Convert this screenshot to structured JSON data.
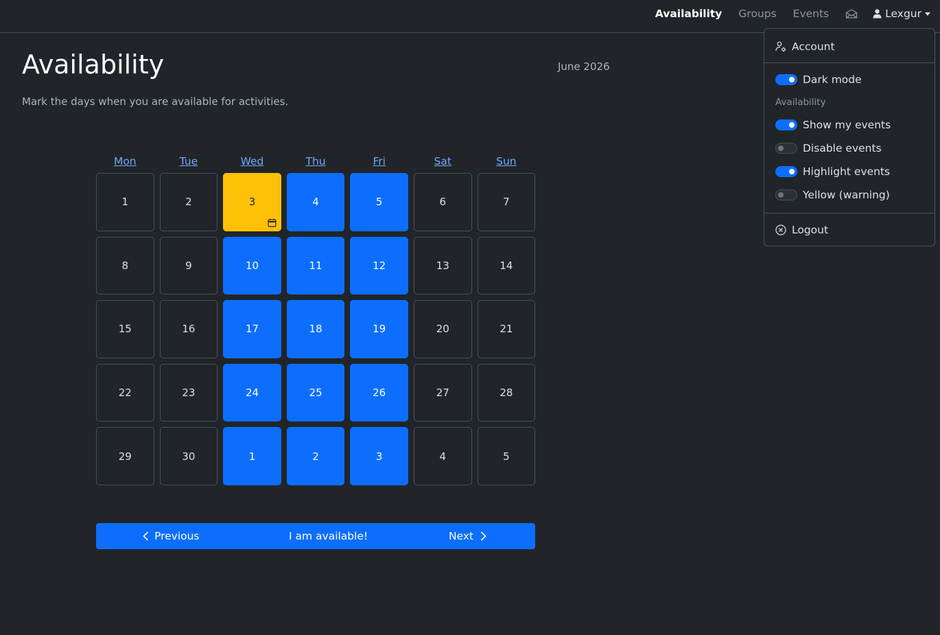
{
  "nav": {
    "availability": "Availability",
    "groups": "Groups",
    "events": "Events",
    "user": "Lexgur"
  },
  "page": {
    "title": "Availability",
    "subtitle": "Mark the days when you are available for activities.",
    "month": "June 2026"
  },
  "calendar": {
    "weekdays": [
      "Mon",
      "Tue",
      "Wed",
      "Thu",
      "Fri",
      "Sat",
      "Sun"
    ],
    "days": [
      {
        "label": "1",
        "state": "default"
      },
      {
        "label": "2",
        "state": "default"
      },
      {
        "label": "3",
        "state": "today",
        "has_event": true
      },
      {
        "label": "4",
        "state": "available"
      },
      {
        "label": "5",
        "state": "available"
      },
      {
        "label": "6",
        "state": "default"
      },
      {
        "label": "7",
        "state": "default"
      },
      {
        "label": "8",
        "state": "default"
      },
      {
        "label": "9",
        "state": "default"
      },
      {
        "label": "10",
        "state": "available"
      },
      {
        "label": "11",
        "state": "available"
      },
      {
        "label": "12",
        "state": "available"
      },
      {
        "label": "13",
        "state": "default"
      },
      {
        "label": "14",
        "state": "default"
      },
      {
        "label": "15",
        "state": "default"
      },
      {
        "label": "16",
        "state": "default"
      },
      {
        "label": "17",
        "state": "available"
      },
      {
        "label": "18",
        "state": "available"
      },
      {
        "label": "19",
        "state": "available"
      },
      {
        "label": "20",
        "state": "default"
      },
      {
        "label": "21",
        "state": "default"
      },
      {
        "label": "22",
        "state": "default"
      },
      {
        "label": "23",
        "state": "default"
      },
      {
        "label": "24",
        "state": "available"
      },
      {
        "label": "25",
        "state": "available"
      },
      {
        "label": "26",
        "state": "available"
      },
      {
        "label": "27",
        "state": "default"
      },
      {
        "label": "28",
        "state": "default"
      },
      {
        "label": "29",
        "state": "default"
      },
      {
        "label": "30",
        "state": "default"
      },
      {
        "label": "1",
        "state": "available"
      },
      {
        "label": "2",
        "state": "available"
      },
      {
        "label": "3",
        "state": "available"
      },
      {
        "label": "4",
        "state": "default"
      },
      {
        "label": "5",
        "state": "default"
      }
    ]
  },
  "actions": {
    "previous": "Previous",
    "available": "I am available!",
    "next": "Next"
  },
  "menu": {
    "account": "Account",
    "dark_mode": "Dark mode",
    "dark_mode_on": true,
    "section_header": "Availability",
    "show_my_events": "Show my events",
    "show_my_events_on": true,
    "disable_events": "Disable events",
    "disable_events_on": false,
    "highlight_events": "Highlight events",
    "highlight_events_on": true,
    "yellow_warning": "Yellow (warning)",
    "yellow_warning_on": false,
    "logout": "Logout"
  },
  "colors": {
    "background": "#212529",
    "primary": "#0d6efd",
    "warning": "#ffc107",
    "link": "#6ea8fe",
    "border": "#495057"
  },
  "icons": [
    "envelope-icon",
    "person-icon",
    "person-gear-icon",
    "calendar-icon",
    "chevron-left-icon",
    "chevron-right-icon",
    "x-circle-icon"
  ]
}
